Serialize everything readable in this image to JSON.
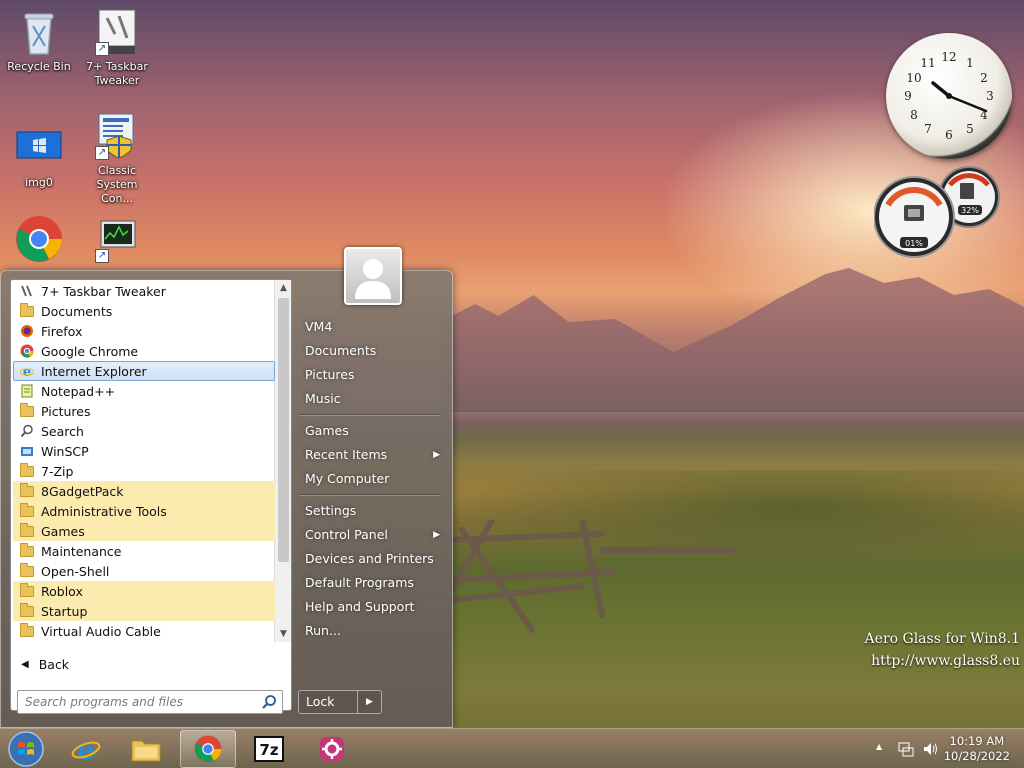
{
  "desktop": {
    "icons": [
      {
        "label": "Recycle Bin"
      },
      {
        "label": "7+ Taskbar Tweaker"
      },
      {
        "label": "img0"
      },
      {
        "label": "Classic System Con..."
      },
      {
        "label": "Google Chrome"
      },
      {
        "label": "Classic Task Manager"
      }
    ],
    "watermark": {
      "line1": "Aero Glass for Win8.1",
      "line2": "http://www.glass8.eu"
    }
  },
  "gadgets": {
    "clock": {
      "numbers": [
        "12",
        "1",
        "2",
        "3",
        "4",
        "5",
        "6",
        "7",
        "8",
        "9",
        "10",
        "11"
      ],
      "time": "10:19"
    },
    "cpu_meter": {
      "cpu": "01%",
      "memory": "32%"
    }
  },
  "start_menu": {
    "programs": [
      {
        "label": "7+ Taskbar Tweaker",
        "icon": "tweaker-icon",
        "state": "normal"
      },
      {
        "label": "Documents",
        "icon": "documents-icon",
        "state": "normal"
      },
      {
        "label": "Firefox",
        "icon": "firefox-icon",
        "state": "normal"
      },
      {
        "label": "Google Chrome",
        "icon": "chrome-icon",
        "state": "normal"
      },
      {
        "label": "Internet Explorer",
        "icon": "ie-icon",
        "state": "selected"
      },
      {
        "label": "Notepad++",
        "icon": "notepadpp-icon",
        "state": "normal"
      },
      {
        "label": "Pictures",
        "icon": "pictures-icon",
        "state": "normal"
      },
      {
        "label": "Search",
        "icon": "search-icon",
        "state": "normal"
      },
      {
        "label": "WinSCP",
        "icon": "winscp-icon",
        "state": "normal"
      },
      {
        "label": "7-Zip",
        "icon": "folder-icon",
        "state": "normal"
      },
      {
        "label": "8GadgetPack",
        "icon": "folder-icon",
        "state": "highlight"
      },
      {
        "label": "Administrative Tools",
        "icon": "folder-icon",
        "state": "highlight"
      },
      {
        "label": "Games",
        "icon": "folder-icon",
        "state": "highlight"
      },
      {
        "label": "Maintenance",
        "icon": "folder-icon",
        "state": "normal"
      },
      {
        "label": "Open-Shell",
        "icon": "folder-icon",
        "state": "normal"
      },
      {
        "label": "Roblox",
        "icon": "folder-icon",
        "state": "highlight"
      },
      {
        "label": "Startup",
        "icon": "folder-icon",
        "state": "highlight"
      },
      {
        "label": "Virtual Audio Cable",
        "icon": "folder-icon",
        "state": "normal"
      }
    ],
    "back_label": "Back",
    "search_placeholder": "Search programs and files",
    "right_items": [
      {
        "label": "VM4",
        "submenu": false
      },
      {
        "label": "Documents",
        "submenu": false
      },
      {
        "label": "Pictures",
        "submenu": false
      },
      {
        "label": "Music",
        "submenu": false
      },
      {
        "label": "Games",
        "submenu": false
      },
      {
        "label": "Recent Items",
        "submenu": true
      },
      {
        "label": "My Computer",
        "submenu": false
      },
      {
        "label": "Settings",
        "submenu": false
      },
      {
        "label": "Control Panel",
        "submenu": true
      },
      {
        "label": "Devices and Printers",
        "submenu": false
      },
      {
        "label": "Default Programs",
        "submenu": false
      },
      {
        "label": "Help and Support",
        "submenu": false
      },
      {
        "label": "Run...",
        "submenu": false
      }
    ],
    "lock_label": "Lock"
  },
  "taskbar": {
    "buttons": [
      {
        "name": "internet-explorer",
        "icon": "ie-icon",
        "active": false
      },
      {
        "name": "file-explorer",
        "icon": "folder-icon",
        "active": false
      },
      {
        "name": "google-chrome",
        "icon": "chrome-icon",
        "active": true
      },
      {
        "name": "7zip",
        "icon": "7z-icon",
        "active": false
      },
      {
        "name": "app",
        "icon": "gear-app-icon",
        "active": false
      }
    ],
    "clock": {
      "time": "10:19 AM",
      "date": "10/28/2022"
    }
  },
  "colors": {
    "folder_highlight": "#fcebaf",
    "selection": "#cfe0f6",
    "selection_border": "#7da2ce"
  }
}
